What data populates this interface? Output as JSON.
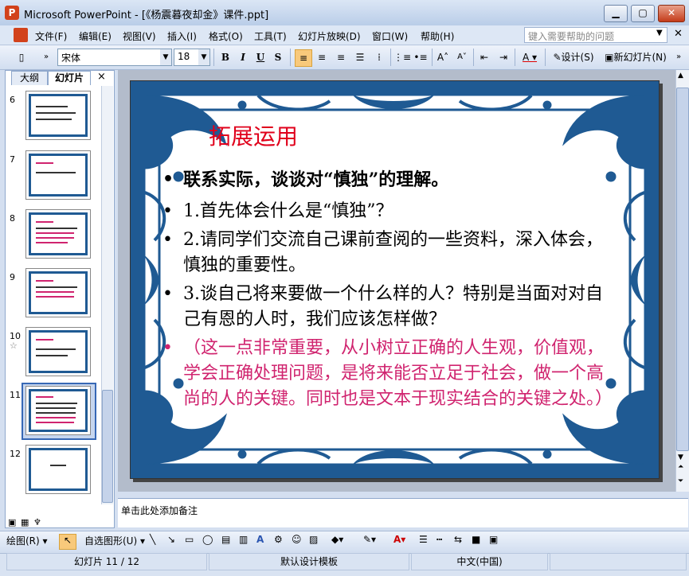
{
  "window": {
    "title": "Microsoft PowerPoint - [《杨震暮夜却金》课件.ppt]",
    "app_icon_letter": "P"
  },
  "menu": [
    "文件(F)",
    "编辑(E)",
    "视图(V)",
    "插入(I)",
    "格式(O)",
    "工具(T)",
    "幻灯片放映(D)",
    "窗口(W)",
    "帮助(H)"
  ],
  "help_placeholder": "键入需要帮助的问题",
  "toolbar": {
    "font": "宋体",
    "size": "18",
    "bold": "B",
    "italic": "I",
    "underline": "U",
    "shadow": "S",
    "design_label": "设计(S)",
    "new_slide_label": "新幻灯片(N)"
  },
  "panel": {
    "tab_outline": "大纲",
    "tab_slides": "幻灯片",
    "close": "×",
    "thumb_numbers": [
      "6",
      "7",
      "8",
      "9",
      "10",
      "11",
      "12"
    ],
    "selected_slide": "11"
  },
  "slide": {
    "title": "拓展运用",
    "bullets": [
      {
        "dot": "•",
        "text": "联系实际，谈谈对“慎独”的理解。"
      },
      {
        "dot": "•",
        "text": "1.首先体会什么是“慎独”？"
      },
      {
        "dot": "•",
        "text": "2.请同学们交流自己课前查阅的一些资料，深入体会，慎独的重要性。"
      },
      {
        "dot": "•",
        "text": "3.谈自己将来要做一个什么样的人？特别是当面对对自己有恩的人时，我们应该怎样做？"
      },
      {
        "dot": "•",
        "text": "（这一点非常重要，从小树立正确的人生观，价值观，学会正确处理问题，是将来能否立足于社会，做一个高尚的人的关键。同时也是文本于现实结合的关键之处。）"
      }
    ],
    "accent_color": "#d0246f",
    "border_color": "#1f5a93"
  },
  "notes_placeholder": "单击此处添加备注",
  "draw_toolbar": {
    "draw_label": "绘图(R)",
    "autoshape_label": "自选图形(U)"
  },
  "status": {
    "slide_pos": "幻灯片 11 / 12",
    "template": "默认设计模板",
    "language": "中文(中国)"
  }
}
